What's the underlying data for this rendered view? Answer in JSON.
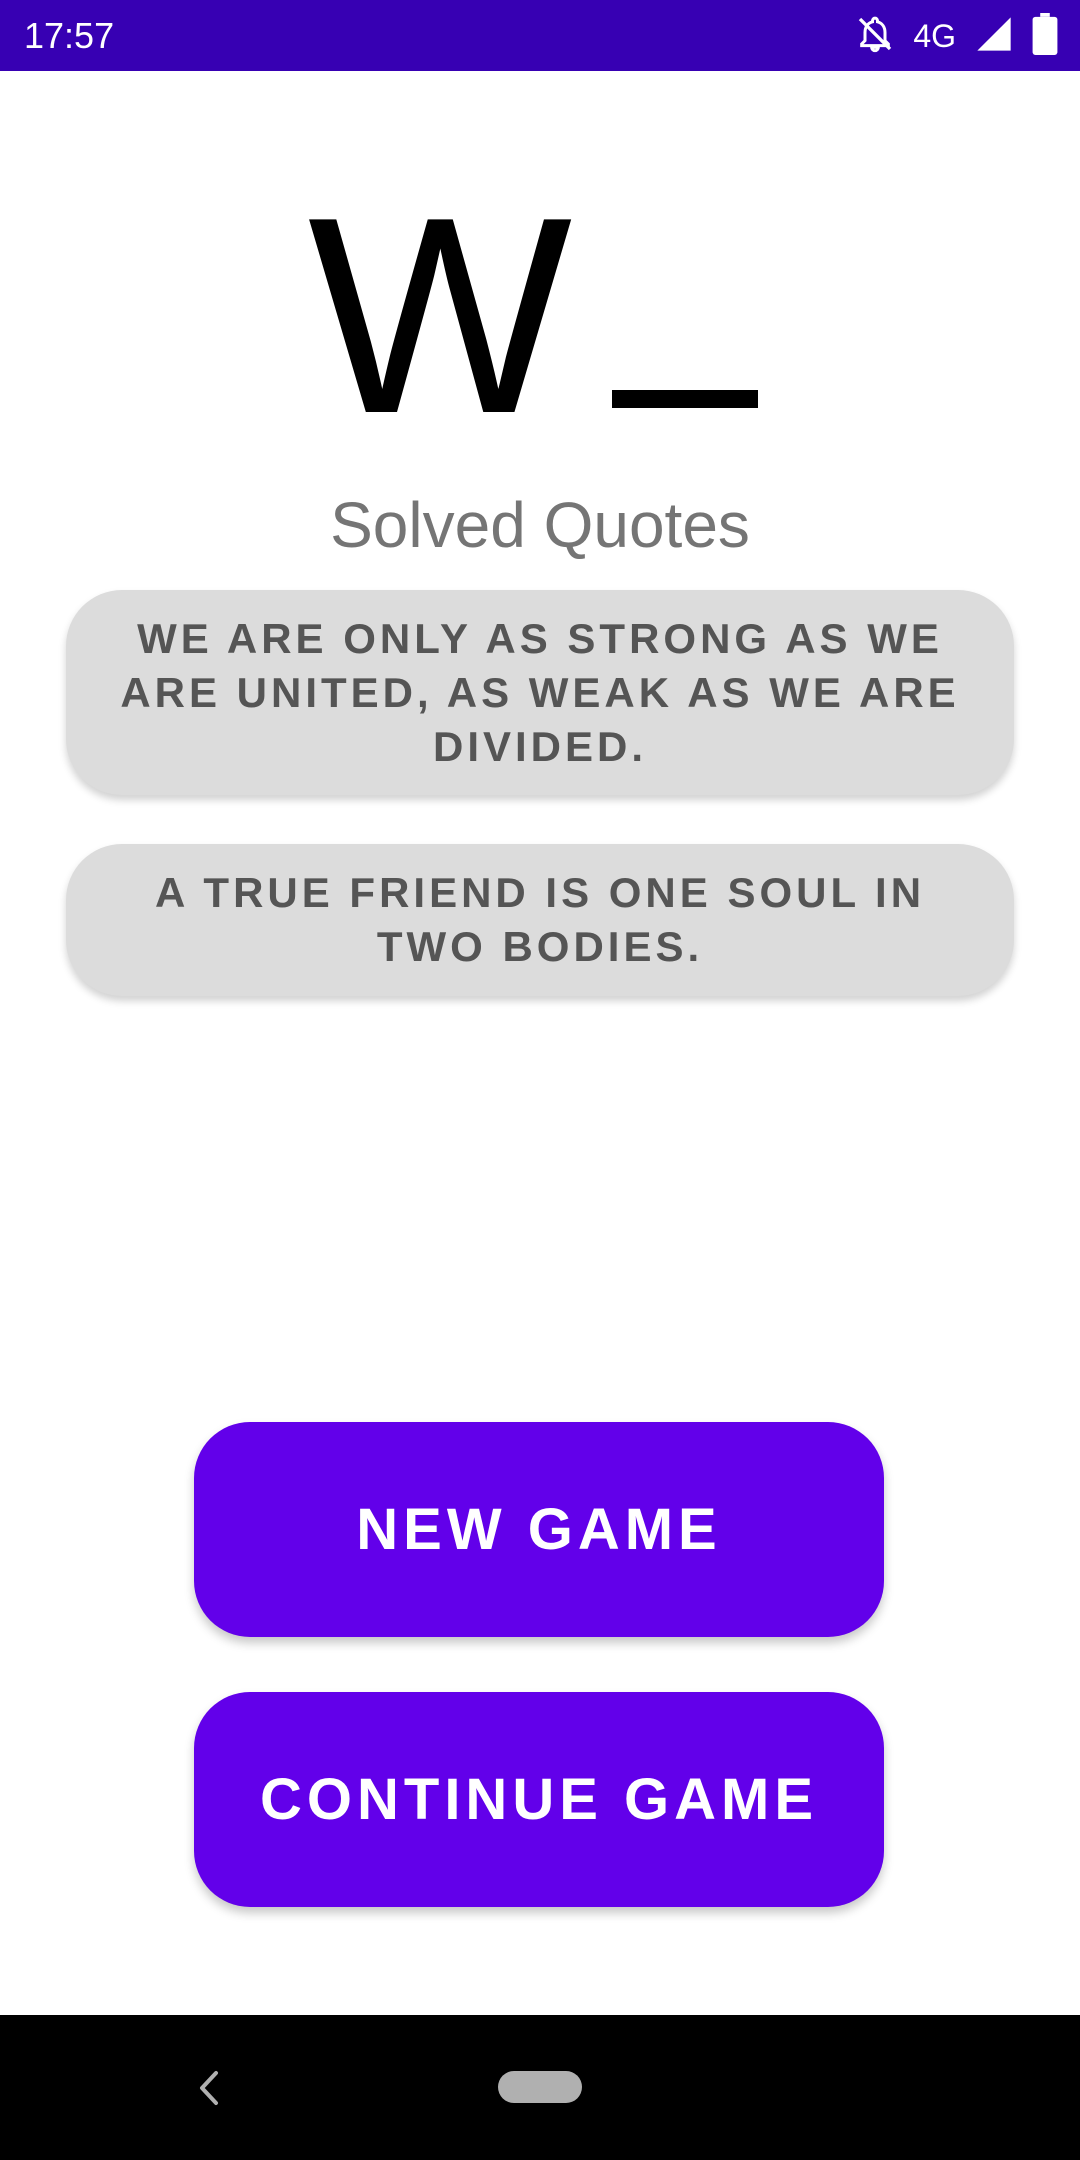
{
  "status_bar": {
    "time": "17:57",
    "network_type": "4G",
    "icons": [
      "notifications-off-icon",
      "signal-icon",
      "battery-icon"
    ],
    "background_color": "#3700b3"
  },
  "logo": {
    "letter": "W",
    "icon": "underscore-dash"
  },
  "subtitle": "Solved Quotes",
  "quotes": [
    "WE ARE ONLY AS STRONG AS WE ARE UNITED, AS WEAK AS WE ARE DIVIDED.",
    "A TRUE FRIEND IS ONE SOUL IN TWO BODIES."
  ],
  "buttons": {
    "new_game": "NEW GAME",
    "continue_game": "CONTINUE GAME",
    "color": "#6200ea"
  },
  "nav_bar": {
    "icons": [
      "back-icon",
      "home-pill-icon"
    ]
  }
}
